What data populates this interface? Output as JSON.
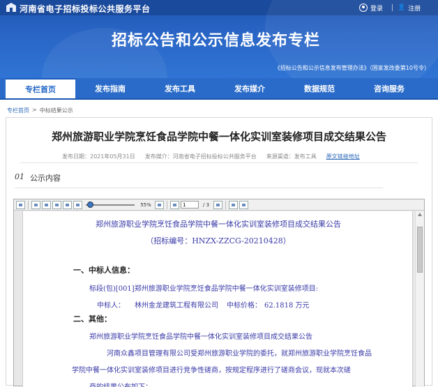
{
  "header": {
    "site_title": "河南省电子招标投标公共服务平台",
    "login_label": "登录",
    "register_label": "注册",
    "banner_title": "招标公告和公示信息发布专栏",
    "banner_subtitle": "《招标公告和公示信息发布管理办法》（国家发改委第10号令）"
  },
  "nav": {
    "items": [
      {
        "label": "专栏首页",
        "active": true
      },
      {
        "label": "发布指南"
      },
      {
        "label": "发布工具"
      },
      {
        "label": "发布媒介"
      },
      {
        "label": "数据规范"
      },
      {
        "label": "咨询服务"
      }
    ]
  },
  "breadcrumb": {
    "home": "专栏首页",
    "sep": ">",
    "current": "中标结果公示"
  },
  "notice": {
    "title": "郑州旅游职业学院烹饪食品学院中餐一体化实训室装修项目成交结果公告",
    "publish_time": "发布日期：2021年05月31日",
    "publisher": "发布媒介：河南省电子招标投标公共服务平台",
    "source": "来源渠道：发布工具",
    "original_link": "原文链接地址",
    "section_num": "01",
    "section_label": "公示内容"
  },
  "pdf_toolbar": {
    "zoom": "55%",
    "page": "1",
    "total": "/ 3"
  },
  "pdf": {
    "title": "郑州旅游职业学院烹饪食品学院中餐一体化实训室装修项目成交结果公告",
    "code": "（招标编号：HNZX-ZZCG-20210428）",
    "s1": "一、中标人信息：",
    "lot": "标段(包)[001]郑州旅游职业学院烹饪食品学院中餐一体化实训室装修项目:",
    "winner_label": "中标人：",
    "winner": "林州金龙建筑工程有限公司",
    "price_label": "中标价格：",
    "price": "62.1818 万元",
    "s2": "二、其他：",
    "p1": "郑州旅游职业学院烹饪食品学院中餐一体化实训室装修项目成交结果公告",
    "p2": "河南众鑫项目管理有限公司受郑州旅游职业学院的委托，就郑州旅游职业学院烹饪食品",
    "p3": "学院中餐一体化实训室装修项目进行竞争性磋商，按规定程序进行了磋商会议，现就本次磋",
    "p4": "商的结果公布如下："
  }
}
